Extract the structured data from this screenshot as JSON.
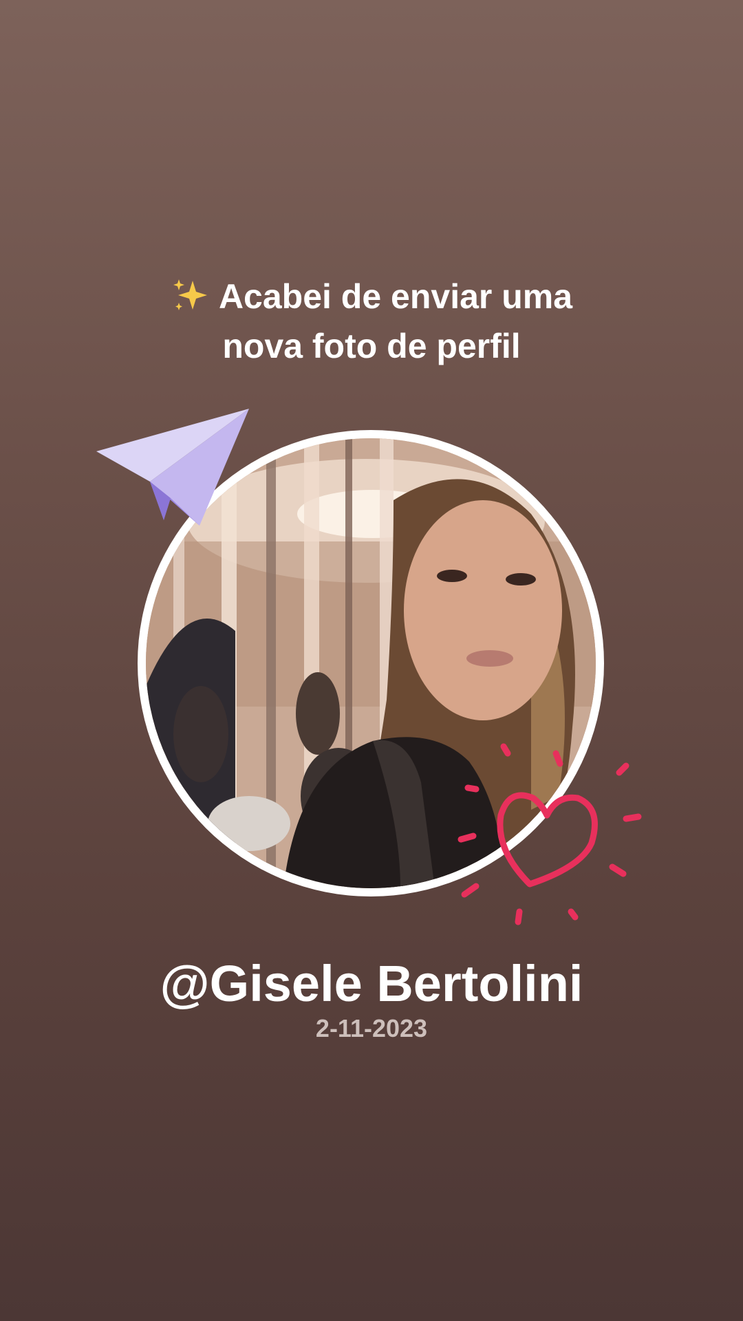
{
  "headline": {
    "emoji": "✨",
    "line1": "Acabei de enviar uma",
    "line2": "nova foto de perfil"
  },
  "profile": {
    "username": "@Gisele Bertolini",
    "date": "2-11-2023"
  },
  "icons": {
    "sparkle": "sparkles-icon",
    "plane": "paper-plane-icon",
    "heart": "heart-doodle-icon"
  },
  "colors": {
    "background_top": "#7d625a",
    "background_bottom": "#4c3735",
    "heart": "#e8305c",
    "plane": "#b6a7ea"
  }
}
